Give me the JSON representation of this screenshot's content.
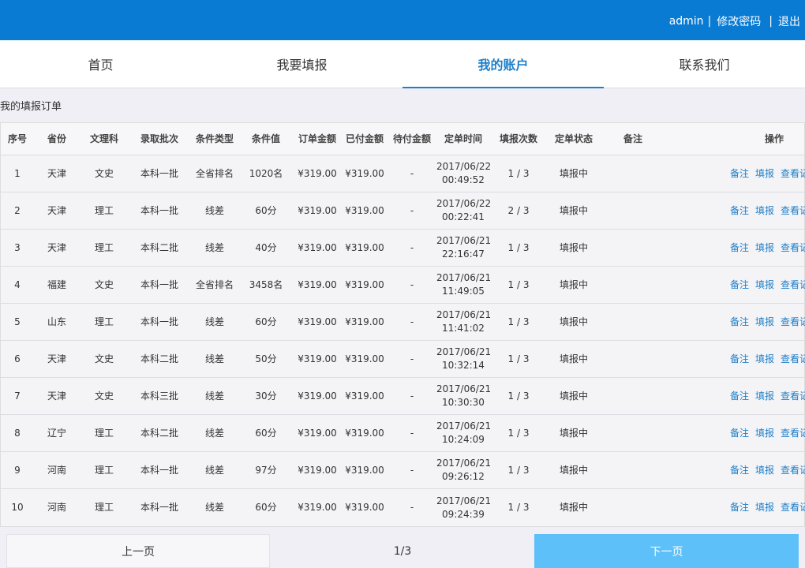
{
  "topbar": {
    "user": "admin",
    "separator": "|",
    "change_password": "修改密码",
    "logout": "退出"
  },
  "nav": [
    {
      "label": "首页"
    },
    {
      "label": "我要填报"
    },
    {
      "label": "我的账户"
    },
    {
      "label": "联系我们"
    }
  ],
  "section_title": "我的填报订单",
  "columns": [
    "序号",
    "省份",
    "文理科",
    "录取批次",
    "条件类型",
    "条件值",
    "订单金额",
    "已付金额",
    "待付金额",
    "定单时间",
    "填报次数",
    "定单状态",
    "备注",
    "操作"
  ],
  "ops": {
    "note": "备注",
    "fill": "填报",
    "view": "查看记录"
  },
  "rows": [
    {
      "no": "1",
      "province": "天津",
      "subject": "文史",
      "batch": "本科一批",
      "cond_type": "全省排名",
      "cond_value": "1020名",
      "order_amount": "¥319.00",
      "paid": "¥319.00",
      "due": "-",
      "date": "2017/06/22",
      "time": "00:49:52",
      "count": "1 / 3",
      "status": "填报中",
      "remark": ""
    },
    {
      "no": "2",
      "province": "天津",
      "subject": "理工",
      "batch": "本科一批",
      "cond_type": "线差",
      "cond_value": "60分",
      "order_amount": "¥319.00",
      "paid": "¥319.00",
      "due": "-",
      "date": "2017/06/22",
      "time": "00:22:41",
      "count": "2 / 3",
      "status": "填报中",
      "remark": ""
    },
    {
      "no": "3",
      "province": "天津",
      "subject": "理工",
      "batch": "本科二批",
      "cond_type": "线差",
      "cond_value": "40分",
      "order_amount": "¥319.00",
      "paid": "¥319.00",
      "due": "-",
      "date": "2017/06/21",
      "time": "22:16:47",
      "count": "1 / 3",
      "status": "填报中",
      "remark": ""
    },
    {
      "no": "4",
      "province": "福建",
      "subject": "文史",
      "batch": "本科一批",
      "cond_type": "全省排名",
      "cond_value": "3458名",
      "order_amount": "¥319.00",
      "paid": "¥319.00",
      "due": "-",
      "date": "2017/06/21",
      "time": "11:49:05",
      "count": "1 / 3",
      "status": "填报中",
      "remark": ""
    },
    {
      "no": "5",
      "province": "山东",
      "subject": "理工",
      "batch": "本科一批",
      "cond_type": "线差",
      "cond_value": "60分",
      "order_amount": "¥319.00",
      "paid": "¥319.00",
      "due": "-",
      "date": "2017/06/21",
      "time": "11:41:02",
      "count": "1 / 3",
      "status": "填报中",
      "remark": ""
    },
    {
      "no": "6",
      "province": "天津",
      "subject": "文史",
      "batch": "本科二批",
      "cond_type": "线差",
      "cond_value": "50分",
      "order_amount": "¥319.00",
      "paid": "¥319.00",
      "due": "-",
      "date": "2017/06/21",
      "time": "10:32:14",
      "count": "1 / 3",
      "status": "填报中",
      "remark": ""
    },
    {
      "no": "7",
      "province": "天津",
      "subject": "文史",
      "batch": "本科三批",
      "cond_type": "线差",
      "cond_value": "30分",
      "order_amount": "¥319.00",
      "paid": "¥319.00",
      "due": "-",
      "date": "2017/06/21",
      "time": "10:30:30",
      "count": "1 / 3",
      "status": "填报中",
      "remark": ""
    },
    {
      "no": "8",
      "province": "辽宁",
      "subject": "理工",
      "batch": "本科二批",
      "cond_type": "线差",
      "cond_value": "60分",
      "order_amount": "¥319.00",
      "paid": "¥319.00",
      "due": "-",
      "date": "2017/06/21",
      "time": "10:24:09",
      "count": "1 / 3",
      "status": "填报中",
      "remark": ""
    },
    {
      "no": "9",
      "province": "河南",
      "subject": "理工",
      "batch": "本科一批",
      "cond_type": "线差",
      "cond_value": "97分",
      "order_amount": "¥319.00",
      "paid": "¥319.00",
      "due": "-",
      "date": "2017/06/21",
      "time": "09:26:12",
      "count": "1 / 3",
      "status": "填报中",
      "remark": ""
    },
    {
      "no": "10",
      "province": "河南",
      "subject": "理工",
      "batch": "本科一批",
      "cond_type": "线差",
      "cond_value": "60分",
      "order_amount": "¥319.00",
      "paid": "¥319.00",
      "due": "-",
      "date": "2017/06/21",
      "time": "09:24:39",
      "count": "1 / 3",
      "status": "填报中",
      "remark": ""
    }
  ],
  "pager": {
    "prev": "上一页",
    "page": "1/3",
    "next": "下一页"
  },
  "colors": {
    "topbar": "#0a7bd3",
    "accent": "#1e7fc9",
    "next_button": "#5ec0f8"
  }
}
